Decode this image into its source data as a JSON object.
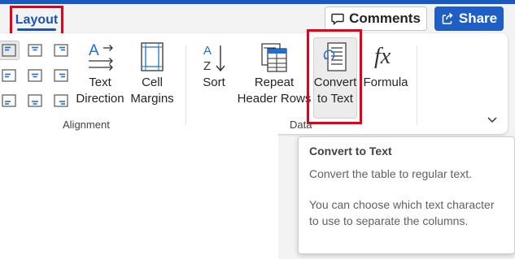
{
  "ribbon_tab": {
    "label": "Layout"
  },
  "header": {
    "comments_label": "Comments",
    "share_label": "Share"
  },
  "commands": {
    "text_direction": "Text\nDirection",
    "cell_margins": "Cell\nMargins",
    "sort": "Sort",
    "repeat_header_rows": "Repeat\nHeader Rows",
    "convert_to_text": "Convert\nto Text",
    "formula": "Formula"
  },
  "groups": {
    "alignment": "Alignment",
    "data": "Data"
  },
  "tooltip": {
    "title": "Convert to Text",
    "line1": "Convert the table to regular text.",
    "line2": "You can choose which text character to use to separate the columns."
  },
  "icons": {
    "comments": "comment-icon",
    "share": "share-icon",
    "expand": "chevron-down-icon"
  },
  "colors": {
    "accent": "#185abd",
    "share_bg": "#1f5fc4",
    "highlight": "#e3001b"
  }
}
